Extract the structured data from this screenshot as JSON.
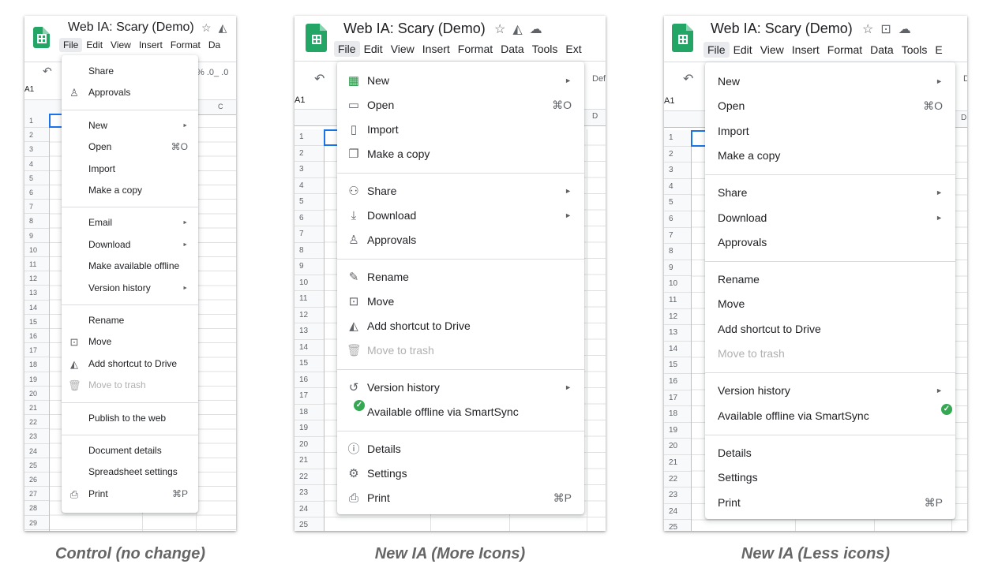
{
  "variants": [
    {
      "caption": "Control (no change)",
      "doc_title": "Web IA: Scary (Demo)",
      "menubar": [
        "File",
        "Edit",
        "View",
        "Insert",
        "Format",
        "Da"
      ],
      "toolbar_overflow": "% .0_ .0",
      "cell_ref": "A1",
      "col_headers": [
        "C"
      ],
      "row_numbers": [
        "1",
        "2",
        "3",
        "4",
        "5",
        "6",
        "7",
        "8",
        "9",
        "10",
        "11",
        "12",
        "13",
        "14",
        "15",
        "16",
        "17",
        "18",
        "19",
        "20",
        "21",
        "22",
        "23",
        "24",
        "25",
        "26",
        "27",
        "28",
        "29"
      ],
      "menu": [
        {
          "label": "Share"
        },
        {
          "label": "Approvals",
          "icon": "approvals-icon"
        },
        {
          "separator": true
        },
        {
          "label": "New",
          "submenu": true
        },
        {
          "label": "Open",
          "shortcut": "⌘O"
        },
        {
          "label": "Import"
        },
        {
          "label": "Make a copy"
        },
        {
          "separator": true
        },
        {
          "label": "Email",
          "submenu": true
        },
        {
          "label": "Download",
          "submenu": true
        },
        {
          "label": "Make available offline"
        },
        {
          "label": "Version history",
          "submenu": true
        },
        {
          "separator": true
        },
        {
          "label": "Rename"
        },
        {
          "label": "Move",
          "icon": "move-icon"
        },
        {
          "label": "Add shortcut to Drive",
          "icon": "drive-shortcut-icon"
        },
        {
          "label": "Move to trash",
          "icon": "trash-icon",
          "disabled": true
        },
        {
          "separator": true
        },
        {
          "label": "Publish to the web"
        },
        {
          "separator": true
        },
        {
          "label": "Document details"
        },
        {
          "label": "Spreadsheet settings"
        },
        {
          "label": "Print",
          "icon": "print-icon",
          "shortcut": "⌘P"
        }
      ]
    },
    {
      "caption": "New IA (More Icons)",
      "doc_title": "Web IA: Scary (Demo)",
      "menubar": [
        "File",
        "Edit",
        "View",
        "Insert",
        "Format",
        "Data",
        "Tools",
        "Ext"
      ],
      "toolbar_overflow": "Def",
      "cell_ref": "A1",
      "col_headers": [
        "D"
      ],
      "row_numbers": [
        "1",
        "2",
        "3",
        "4",
        "5",
        "6",
        "7",
        "8",
        "9",
        "10",
        "11",
        "12",
        "13",
        "14",
        "15",
        "16",
        "17",
        "18",
        "19",
        "20",
        "21",
        "22",
        "23",
        "24",
        "25"
      ],
      "menu": [
        {
          "label": "New",
          "icon": "sheets-new-icon",
          "submenu": true
        },
        {
          "label": "Open",
          "icon": "folder-icon",
          "shortcut": "⌘O"
        },
        {
          "label": "Import",
          "icon": "file-icon"
        },
        {
          "label": "Make a copy",
          "icon": "copy-icon"
        },
        {
          "separator": true
        },
        {
          "label": "Share",
          "icon": "share-person-icon",
          "submenu": true
        },
        {
          "label": "Download",
          "icon": "download-icon",
          "submenu": true
        },
        {
          "label": "Approvals",
          "icon": "approvals-icon"
        },
        {
          "separator": true
        },
        {
          "label": "Rename",
          "icon": "rename-icon"
        },
        {
          "label": "Move",
          "icon": "move-icon"
        },
        {
          "label": "Add shortcut to Drive",
          "icon": "drive-shortcut-icon"
        },
        {
          "label": "Move to trash",
          "icon": "trash-icon",
          "disabled": true
        },
        {
          "separator": true
        },
        {
          "label": "Version history",
          "icon": "history-icon",
          "submenu": true
        },
        {
          "label": "Available offline via SmartSync",
          "icon": "offline-check-icon"
        },
        {
          "separator": true
        },
        {
          "label": "Details",
          "icon": "info-icon"
        },
        {
          "label": "Settings",
          "icon": "settings-icon"
        },
        {
          "label": "Print",
          "icon": "print-icon",
          "shortcut": "⌘P"
        }
      ]
    },
    {
      "caption": "New IA (Less icons)",
      "doc_title": "Web IA: Scary (Demo)",
      "menubar": [
        "File",
        "Edit",
        "View",
        "Insert",
        "Format",
        "Data",
        "Tools",
        "E"
      ],
      "toolbar_overflow": "D",
      "cell_ref": "A1",
      "col_headers": [
        "D"
      ],
      "row_numbers": [
        "1",
        "2",
        "3",
        "4",
        "5",
        "6",
        "7",
        "8",
        "9",
        "10",
        "11",
        "12",
        "13",
        "14",
        "15",
        "16",
        "17",
        "18",
        "19",
        "20",
        "21",
        "22",
        "23",
        "24",
        "25"
      ],
      "menu": [
        {
          "label": "New",
          "submenu": true
        },
        {
          "label": "Open",
          "shortcut": "⌘O"
        },
        {
          "label": "Import"
        },
        {
          "label": "Make a copy"
        },
        {
          "separator": true
        },
        {
          "label": "Share",
          "submenu": true
        },
        {
          "label": "Download",
          "submenu": true
        },
        {
          "label": "Approvals"
        },
        {
          "separator": true
        },
        {
          "label": "Rename"
        },
        {
          "label": "Move"
        },
        {
          "label": "Add shortcut to Drive"
        },
        {
          "label": "Move to trash",
          "disabled": true
        },
        {
          "separator": true
        },
        {
          "label": "Version history",
          "submenu": true
        },
        {
          "label": "Available offline via SmartSync",
          "trailing_icon": "offline-check-icon"
        },
        {
          "separator": true
        },
        {
          "label": "Details"
        },
        {
          "label": "Settings"
        },
        {
          "label": "Print",
          "shortcut": "⌘P"
        }
      ]
    }
  ],
  "icons": {
    "approvals-icon": "♙",
    "move-icon": "⊡",
    "drive-shortcut-icon": "◭",
    "trash-icon": "🗑",
    "print-icon": "⎙",
    "sheets-new-icon": "▦",
    "folder-icon": "▭",
    "file-icon": "▯",
    "copy-icon": "❐",
    "share-person-icon": "⚇",
    "download-icon": "⤓",
    "rename-icon": "✎",
    "history-icon": "↺",
    "offline-check-icon": "✓",
    "info-icon": "ⓘ",
    "settings-icon": "⚙"
  },
  "title_icons": [
    [
      "star-icon",
      "☆"
    ],
    [
      "drive-icon",
      "◭"
    ]
  ],
  "title_icons_v2": [
    [
      "star-icon",
      "☆"
    ],
    [
      "drive-icon",
      "◭"
    ],
    [
      "cloud-icon",
      "☁"
    ]
  ],
  "title_icons_v3": [
    [
      "star-icon",
      "☆"
    ],
    [
      "move-icon",
      "⊡"
    ],
    [
      "cloud-icon",
      "☁"
    ]
  ],
  "submenu_arrow": "►",
  "undo_glyph": "↶",
  "colors": {
    "sheets_green": "#23a566",
    "selection_blue": "#1a73e8",
    "check_green": "#34a853",
    "new_icon_green": "#1e8e3e"
  }
}
